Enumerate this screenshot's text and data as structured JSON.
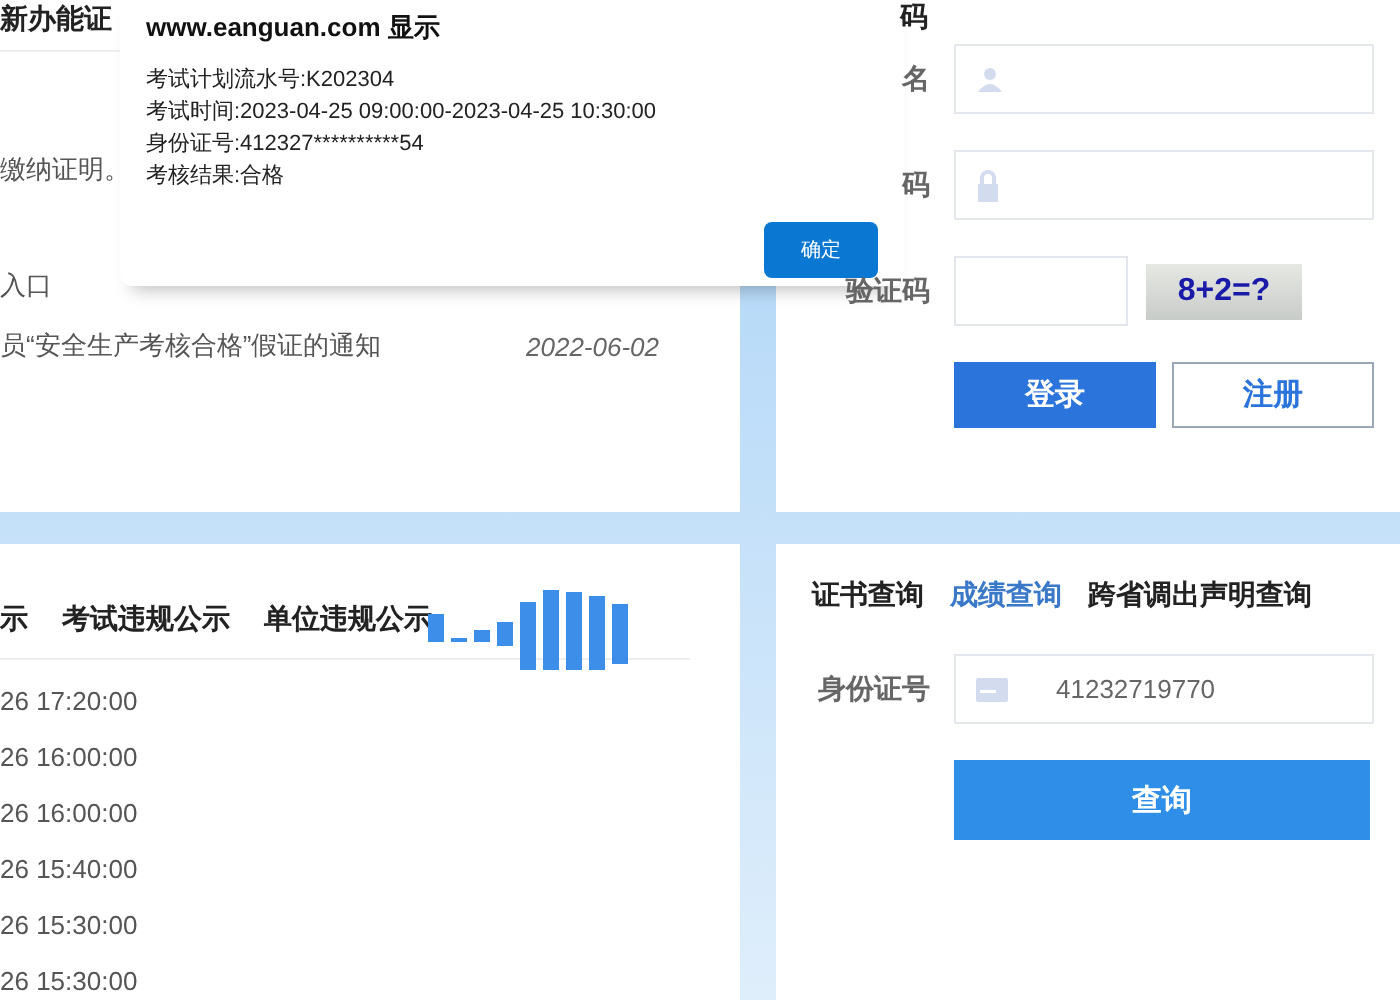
{
  "news": {
    "title": "新办能证",
    "items": [
      {
        "text": "缴纳证明。"
      },
      {
        "text": "入口"
      },
      {
        "text": "员“安全生产考核合格”假证的通知",
        "date": "2022-06-02"
      }
    ]
  },
  "login": {
    "heading": "码",
    "fields": [
      {
        "label": "名",
        "kind": "user"
      },
      {
        "label": "码",
        "kind": "password"
      },
      {
        "label": "验证码",
        "kind": "captcha",
        "captcha": "8+2=?"
      }
    ],
    "buttons": [
      {
        "label": "登录",
        "kind": "primary"
      },
      {
        "label": "注册",
        "kind": "secondary"
      }
    ]
  },
  "notices": {
    "tabs": [
      {
        "label": "示",
        "selected": false
      },
      {
        "label": "考试违规公示",
        "selected": false
      },
      {
        "label": "单位违规公示",
        "selected": false
      }
    ],
    "rows": [
      "26 17:20:00",
      "26 16:00:00",
      "26 16:00:00",
      "26 15:40:00",
      "26 15:30:00",
      "26 15:30:00"
    ]
  },
  "query": {
    "tabs": [
      {
        "label": "证书查询",
        "selected": false
      },
      {
        "label": "成绩查询",
        "selected": true
      },
      {
        "label": "跨省调出声明查询",
        "selected": false
      }
    ],
    "field": {
      "label": "身份证号",
      "value": "41232719770"
    },
    "button": "查询"
  },
  "dialog": {
    "title": "www.eanguan.com 显示",
    "lines": [
      "考试计划流水号:K202304",
      "考试时间:2023-04-25 09:00:00-2023-04-25 10:30:00",
      "身份证号:412327**********54",
      "考核结果:合格"
    ],
    "button": "确定"
  }
}
